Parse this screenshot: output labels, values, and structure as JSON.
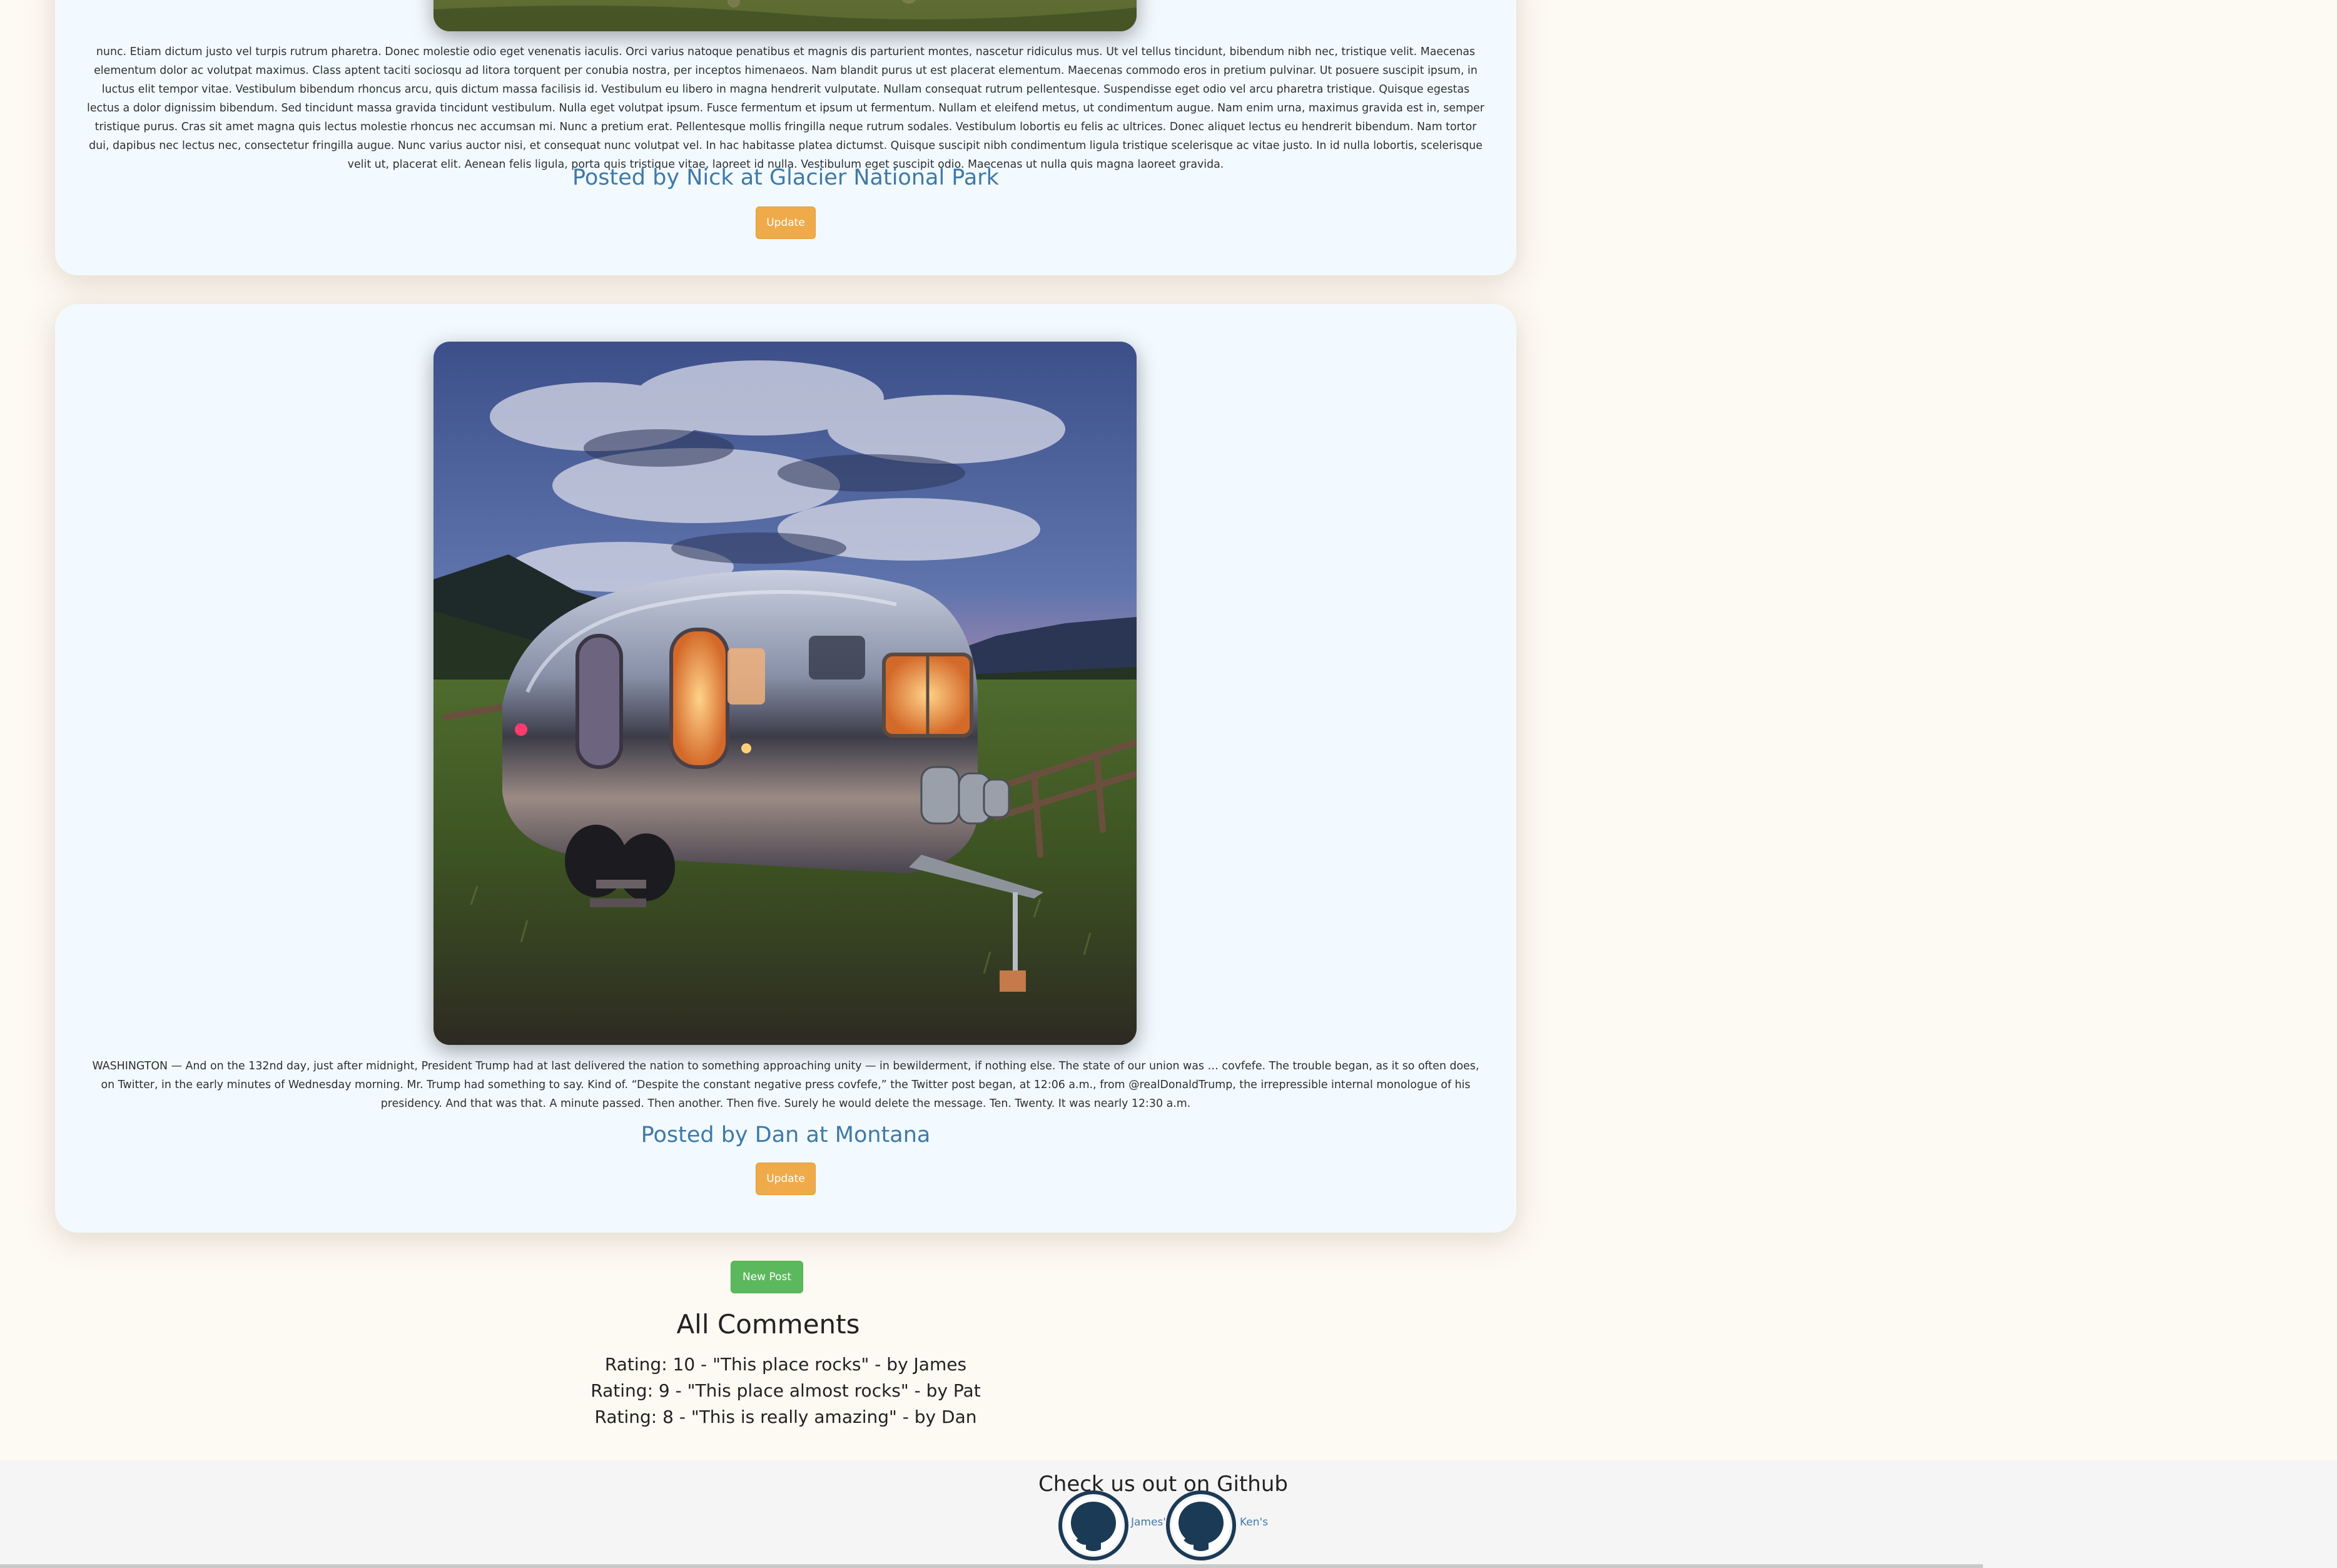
{
  "posts": [
    {
      "body": "nunc. Etiam dictum justo vel turpis rutrum pharetra. Donec molestie odio eget venenatis iaculis. Orci varius natoque penatibus et magnis dis parturient montes, nascetur ridiculus mus. Ut vel tellus tincidunt, bibendum nibh nec, tristique velit. Maecenas elementum dolor ac volutpat maximus. Class aptent taciti sociosqu ad litora torquent per conubia nostra, per inceptos himenaeos. Nam blandit purus ut est placerat elementum. Maecenas commodo eros in pretium pulvinar. Ut posuere suscipit ipsum, in luctus elit tempor vitae. Vestibulum bibendum rhoncus arcu, quis dictum massa facilisis id. Vestibulum eu libero in magna hendrerit vulputate. Nullam consequat rutrum pellentesque. Suspendisse eget odio vel arcu pharetra tristique. Quisque egestas lectus a dolor dignissim bibendum. Sed tincidunt massa gravida tincidunt vestibulum. Nulla eget volutpat ipsum. Fusce fermentum et ipsum ut fermentum. Nullam et eleifend metus, ut condimentum augue. Nam enim urna, maximus gravida est in, semper tristique purus. Cras sit amet magna quis lectus molestie rhoncus nec accumsan mi. Nunc a pretium erat. Pellentesque mollis fringilla neque rutrum sodales. Vestibulum lobortis eu felis ac ultrices. Donec aliquet lectus eu hendrerit bibendum. Nam tortor dui, dapibus nec lectus nec, consectetur fringilla augue. Nunc varius auctor nisi, et consequat nunc volutpat vel. In hac habitasse platea dictumst. Quisque suscipit nibh condimentum ligula tristique scelerisque ac vitae justo. In id nulla lobortis, scelerisque velit ut, placerat elit. Aenean felis ligula, porta quis tristique vitae, laoreet id nulla. Vestibulum eget suscipit odio. Maecenas ut nulla quis magna laoreet gravida.",
      "posted_by": "Posted by Nick at Glacier National Park",
      "update_label": "Update"
    },
    {
      "body": "WASHINGTON — And on the 132nd day, just after midnight, President Trump had at last delivered the nation to something approaching unity — in bewilderment, if nothing else. The state of our union was … covfefe. The trouble began, as it so often does, on Twitter, in the early minutes of Wednesday morning. Mr. Trump had something to say. Kind of. “Despite the constant negative press covfefe,” the Twitter post began, at 12:06 a.m., from @realDonaldTrump, the irrepressible internal monologue of his presidency. And that was that. A minute passed. Then another. Then five. Surely he would delete the message. Ten. Twenty. It was nearly 12:30 a.m.",
      "posted_by": "Posted by Dan at Montana",
      "update_label": "Update"
    }
  ],
  "new_post_label": "New Post",
  "comments": {
    "title": "All Comments",
    "items": [
      "Rating: 10 - \"This place rocks\" - by James",
      "Rating: 9 - \"This place almost rocks\" - by Pat",
      "Rating: 8 - \"This is really amazing\" - by Dan"
    ]
  },
  "footer": {
    "title": "Check us out on Github",
    "links": [
      {
        "label": "James'",
        "icon": "github-icon"
      },
      {
        "label": "Ken's",
        "icon": "github-icon"
      }
    ]
  },
  "colors": {
    "page_bg": "#fdf9f3",
    "card_bg": "#f2faff",
    "link_blue": "#3f79a8",
    "update_orange": "#efab4a",
    "new_post_green": "#5cb85c",
    "github_navy": "#1b3a56"
  }
}
